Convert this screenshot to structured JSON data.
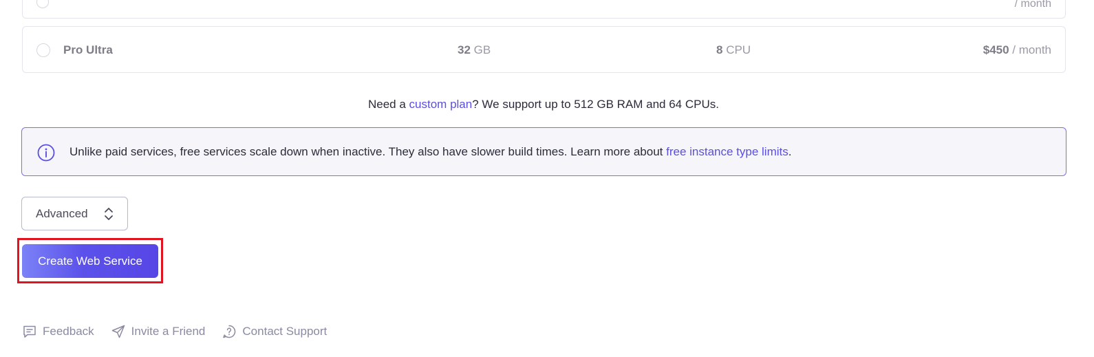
{
  "plans": {
    "previous": {
      "price_partial": "/ month"
    },
    "ultra": {
      "name": "Pro Ultra",
      "ram_value": "32",
      "ram_unit": " GB",
      "cpu_value": "8",
      "cpu_unit": " CPU",
      "price_value": "$450",
      "price_unit": " / month"
    }
  },
  "custom_note": {
    "prefix": "Need a ",
    "link": "custom plan",
    "suffix": "? We support up to 512 GB RAM and 64 CPUs."
  },
  "info": {
    "text": "Unlike paid services, free services scale down when inactive. They also have slower build times. Learn more about ",
    "link": "free instance type limits",
    "end": ".",
    "icon": "info-circle-icon"
  },
  "advanced": {
    "label": "Advanced",
    "icon": "chevron-up-down-icon"
  },
  "create_button": {
    "label": "Create Web Service"
  },
  "footer": {
    "items": [
      {
        "label": "Feedback",
        "icon": "feedback-icon"
      },
      {
        "label": "Invite a Friend",
        "icon": "send-icon"
      },
      {
        "label": "Contact Support",
        "icon": "help-icon"
      }
    ]
  },
  "colors": {
    "accent": "#5a4fe0",
    "highlight": "#e0141e",
    "info_border": "#7b6fe8",
    "info_bg": "#f5f5fa"
  }
}
